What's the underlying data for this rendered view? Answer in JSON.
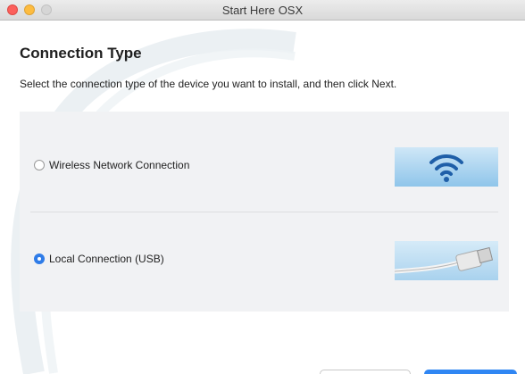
{
  "window": {
    "title": "Start Here OSX"
  },
  "page": {
    "heading": "Connection Type",
    "instruction": "Select the connection type of the device you want to install, and then click Next."
  },
  "options": [
    {
      "label": "Wireless Network Connection",
      "selected": false,
      "image_icon": "wifi-icon"
    },
    {
      "label": "Local Connection (USB)",
      "selected": true,
      "image_icon": "usb-cable-icon"
    }
  ],
  "footer": {
    "back_label": "",
    "next_label": ""
  },
  "colors": {
    "accent": "#2f7ce8",
    "panel": "#f1f2f4",
    "wifi_blue": "#1f5fa8"
  }
}
